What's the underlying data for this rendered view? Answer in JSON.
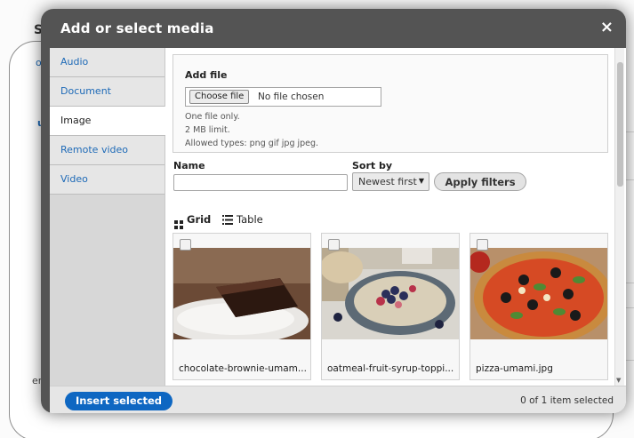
{
  "background": {
    "fragments": [
      "Sa",
      "ont",
      "um",
      "en"
    ]
  },
  "modal": {
    "title": "Add or select media",
    "close_glyph": "×",
    "tabs": [
      {
        "label": "Audio",
        "active": false
      },
      {
        "label": "Document",
        "active": false
      },
      {
        "label": "Image",
        "active": true
      },
      {
        "label": "Remote video",
        "active": false
      },
      {
        "label": "Video",
        "active": false
      }
    ],
    "add_file": {
      "label": "Add file",
      "button_label": "Choose file",
      "status": "No file chosen",
      "help": [
        "One file only.",
        "2 MB limit.",
        "Allowed types: png gif jpg jpeg."
      ]
    },
    "filters": {
      "name_label": "Name",
      "name_value": "",
      "sort_label": "Sort by",
      "sort_value": "Newest first",
      "apply_label": "Apply filters"
    },
    "views": {
      "grid_label": "Grid",
      "table_label": "Table",
      "active": "Grid"
    },
    "media": [
      {
        "label": "chocolate-brownie-umam...",
        "checked": false
      },
      {
        "label": "oatmeal-fruit-syrup-toppi...",
        "checked": false
      },
      {
        "label": "pizza-umami.jpg",
        "checked": false
      }
    ],
    "footer": {
      "insert_label": "Insert selected",
      "count_text": "0 of 1 item selected"
    }
  },
  "colors": {
    "header_bg": "#545454",
    "link": "#1e6ab7",
    "primary_button": "#0e67c2"
  },
  "icons": [
    "close-icon",
    "grid-icon",
    "table-list-icon",
    "dropdown-arrow-icon",
    "scroll-down-icon"
  ]
}
